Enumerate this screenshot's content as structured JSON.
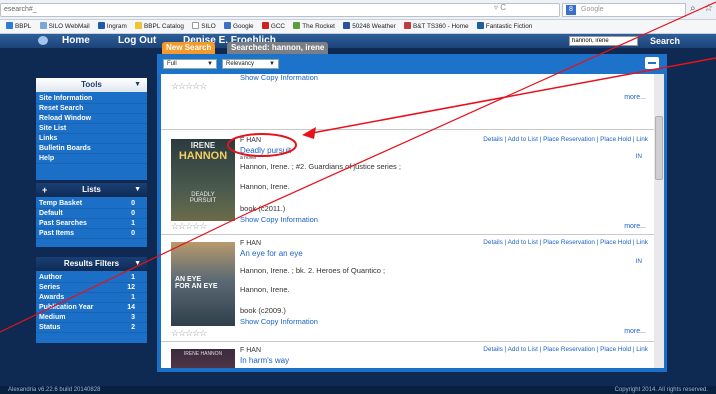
{
  "browser": {
    "url": "esearch#_",
    "search_placeholder": "Google",
    "bookmarks": [
      {
        "label": "BBPL",
        "color": "#2f7bd2"
      },
      {
        "label": "SILO WebMail",
        "color": "#7aa7d8"
      },
      {
        "label": "Ingram",
        "color": "#1e5aa8"
      },
      {
        "label": "BBPL Catalog",
        "color": "#f1c232"
      },
      {
        "label": "SILO",
        "color": "#ffffff"
      },
      {
        "label": "Google",
        "color": "#3a70c8"
      },
      {
        "label": "GCC",
        "color": "#d02020"
      },
      {
        "label": "The Rocket",
        "color": "#5aa03a"
      },
      {
        "label": "50248 Weather",
        "color": "#2b4f9e"
      },
      {
        "label": "B&T TS360 - Home",
        "color": "#c43a3a"
      },
      {
        "label": "Fantastic Fiction",
        "color": "#1c5f9a"
      }
    ]
  },
  "header": {
    "home": "Home",
    "logout": "Log Out",
    "user": "Denise E. Froehlich",
    "search_value": "hannon, irene",
    "search_button": "Search"
  },
  "tools": {
    "title": "Tools",
    "items": [
      "Site Information",
      "Reset Search",
      "Reload Window",
      "Site List",
      "Links",
      "Bulletin Boards",
      "Help"
    ]
  },
  "lists": {
    "title": "Lists",
    "items": [
      {
        "label": "Temp Basket",
        "count": "0"
      },
      {
        "label": "Default",
        "count": "0"
      },
      {
        "label": "Past Searches",
        "count": "1"
      },
      {
        "label": "Past Items",
        "count": "0"
      }
    ]
  },
  "filters": {
    "title": "Results Filters",
    "items": [
      {
        "label": "Author",
        "count": "1"
      },
      {
        "label": "Series",
        "count": "12"
      },
      {
        "label": "Awards",
        "count": "1"
      },
      {
        "label": "Publication Year",
        "count": "14"
      },
      {
        "label": "Medium",
        "count": "3"
      },
      {
        "label": "Status",
        "count": "2"
      }
    ]
  },
  "tabs": {
    "new_search": "New Search",
    "searched": "Searched: hannon, irene"
  },
  "toolbar": {
    "view": "Full",
    "sort": "Relevancy"
  },
  "colors": {
    "accent_orange": "#f39a2a",
    "panel_blue": "#1b6fc6",
    "annotation_red": "#e8101a"
  },
  "records": [
    {
      "partial": true,
      "show_copy": "Show Copy Information",
      "more": "more..."
    },
    {
      "call": "F HAN",
      "title": "Deadly pursuit",
      "type_label": "a novel",
      "series": "Hannon, Irene. ; #2. Guardians of justice series ;",
      "author": "Hannon, Irene.",
      "format": "book   (c2011.)",
      "show_copy": "Show Copy Information",
      "actions": "Details | Add to List | Place Reservation | Place Hold | Link",
      "status": "IN",
      "more": "more...",
      "cover_text": [
        "IRENE",
        "HANNON",
        "DEADLY",
        "PURSUIT"
      ]
    },
    {
      "call": "F HAN",
      "title": "An eye for an eye",
      "series": "Hannon, Irene. ; bk. 2. Heroes of Quantico ;",
      "author": "Hannon, Irene.",
      "format": "book   (c2009.)",
      "show_copy": "Show Copy Information",
      "actions": "Details | Add to List | Place Reservation | Place Hold | Link",
      "status": "IN",
      "more": "more...",
      "cover_text": [
        "AN EYE",
        "FOR AN EYE"
      ]
    },
    {
      "call": "F HAN",
      "title": "In harm's way",
      "actions": "Details | Add to List | Place Reservation | Place Hold | Link",
      "cover_text": [
        "IRENE HANNON"
      ]
    }
  ],
  "footer": {
    "left": "Alexandria v6.22.6 build 20140828",
    "right": "Copyright 2014. All rights reserved."
  }
}
